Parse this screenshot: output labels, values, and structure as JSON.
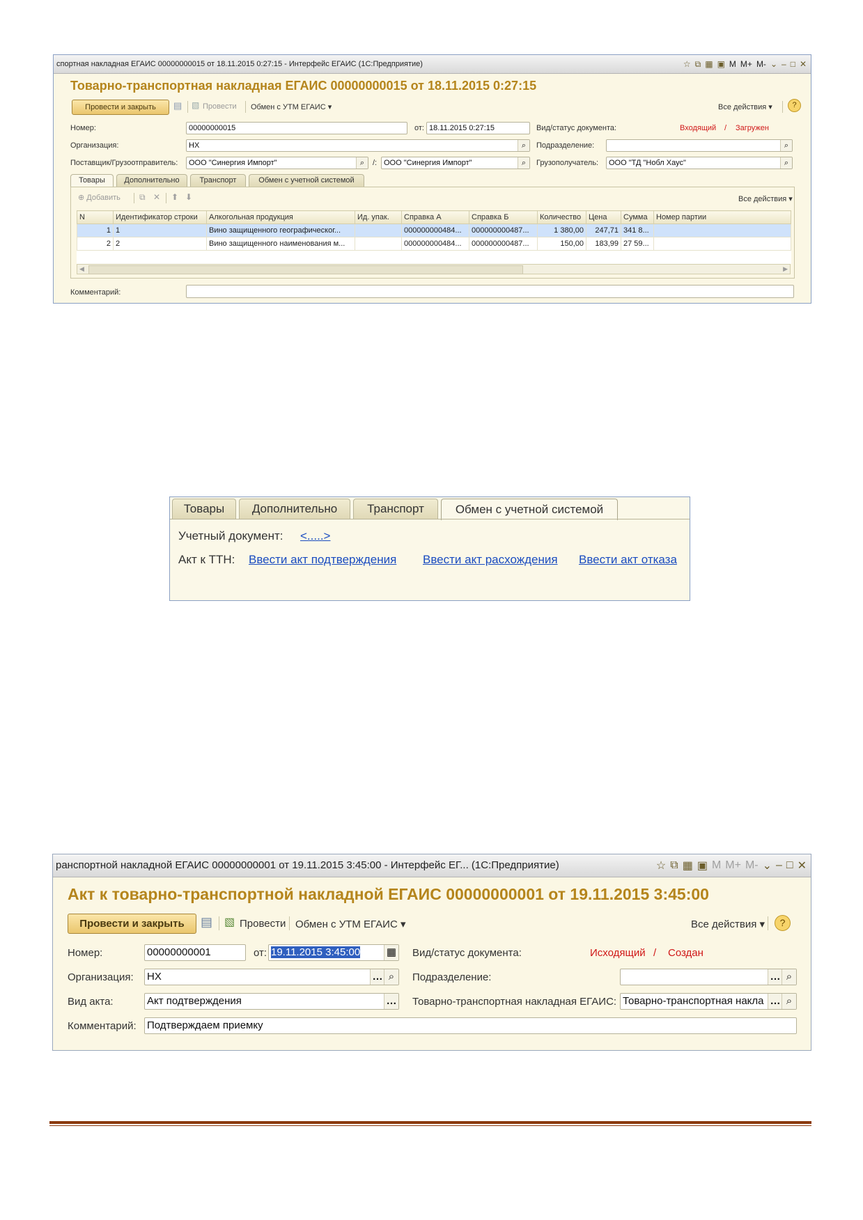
{
  "shot1": {
    "window_title": "спортная накладная ЕГАИС 00000000015 от 18.11.2015 0:27:15 - Интерфейс ЕГАИС  (1С:Предприятие)",
    "title_buttons": [
      "M",
      "M+",
      "M-"
    ],
    "doc_title": "Товарно-транспортная накладная ЕГАИС 00000000015 от 18.11.2015 0:27:15",
    "post_close_label": "Провести и закрыть",
    "post_label": "Провести",
    "exchange_label": "Обмен с УТМ ЕГАИС",
    "all_actions_label": "Все действия",
    "number_label": "Номер:",
    "number_value": "00000000015",
    "date_label": "от:",
    "date_value": "18.11.2015  0:27:15",
    "status_label": "Вид/статус документа:",
    "status_kind": "Входящий",
    "status_sep": "/",
    "status_state": "Загружен",
    "org_label": "Организация:",
    "org_value": "НХ",
    "subdiv_label": "Подразделение:",
    "subdiv_value": "",
    "supplier_label": "Поставщик/Грузоотправитель:",
    "supplier_value": "ООО \"Синергия Импорт\"",
    "shipper_sep": "/:",
    "shipper_value": "ООО \"Синергия Импорт\"",
    "consignee_label": "Грузополучатель:",
    "consignee_value": "ООО \"ТД \"Нобл Хаус\"",
    "tabs": [
      "Товары",
      "Дополнительно",
      "Транспорт",
      "Обмен с учетной системой"
    ],
    "add_label": "Добавить",
    "table_all_actions": "Все действия",
    "columns": [
      "N",
      "Идентификатор строки",
      "Алкогольная продукция",
      "Ид. упак.",
      "Справка А",
      "Справка Б",
      "Количество",
      "Цена",
      "Сумма",
      "Номер партии"
    ],
    "rows": [
      [
        "1",
        "1",
        "Вино защищенного географическог...",
        "",
        "000000000484...",
        "000000000487...",
        "1 380,00",
        "247,71",
        "341 8...",
        ""
      ],
      [
        "2",
        "2",
        "Вино защищенного наименования м...",
        "",
        "000000000484...",
        "000000000487...",
        "150,00",
        "183,99",
        "27 59...",
        ""
      ]
    ],
    "comment_label": "Комментарий:",
    "comment_value": ""
  },
  "shot2": {
    "tabs": [
      "Товары",
      "Дополнительно",
      "Транспорт",
      "Обмен с учетной системой"
    ],
    "acc_doc_label": "Учетный документ:",
    "acc_doc_link": "<.....>",
    "act_label": "Акт к ТТН:",
    "link_confirm": "Ввести акт подтверждения",
    "link_discrepancy": "Ввести акт расхождения",
    "link_refusal": "Ввести акт отказа"
  },
  "shot3": {
    "window_title": "ранспортной накладной ЕГАИС 00000000001 от 19.11.2015 3:45:00 - Интерфейс ЕГ...  (1С:Предприятие)",
    "title_buttons": [
      "M",
      "M+",
      "M-"
    ],
    "doc_title": "Акт к товарно-транспортной накладной ЕГАИС 00000000001 от 19.11.2015 3:45:00",
    "post_close_label": "Провести и закрыть",
    "post_label": "Провести",
    "exchange_label": "Обмен с УТМ ЕГАИС",
    "all_actions_label": "Все действия",
    "number_label": "Номер:",
    "number_value": "00000000001",
    "date_label": "от:",
    "date_value": "19.11.2015  3:45:00",
    "status_label": "Вид/статус документа:",
    "status_kind": "Исходящий",
    "status_sep": "/",
    "status_state": "Создан",
    "org_label": "Организация:",
    "org_value": "НХ",
    "subdiv_label": "Подразделение:",
    "subdiv_value": "",
    "act_kind_label": "Вид акта:",
    "act_kind_value": "Акт подтверждения",
    "ttn_label": "Товарно-транспортная накладная ЕГАИС:",
    "ttn_value": "Товарно-транспортная накла",
    "comment_label": "Комментарий:",
    "comment_value": "Подтверждаем приемку"
  },
  "colors": {
    "title_gold": "#b5851c",
    "status_red": "#d01818",
    "link_blue": "#1a4cc0",
    "footer_rule": "#8b3a0e"
  }
}
